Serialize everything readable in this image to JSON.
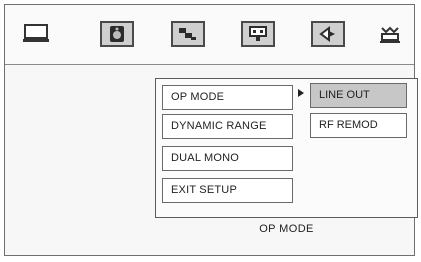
{
  "menu": {
    "items": [
      {
        "label": "OP MODE"
      },
      {
        "label": "DYNAMIC RANGE"
      },
      {
        "label": "DUAL MONO"
      },
      {
        "label": "EXIT SETUP"
      }
    ],
    "submenu": [
      {
        "label": "LINE OUT",
        "selected": true
      },
      {
        "label": "RF REMOD",
        "selected": false
      }
    ]
  },
  "status": {
    "label": "OP MODE"
  },
  "tabs": [
    {
      "icon": "tv-icon"
    },
    {
      "icon": "speaker-box-icon"
    },
    {
      "icon": "picture-icon"
    },
    {
      "icon": "rating-icon"
    },
    {
      "icon": "audio-icon"
    },
    {
      "icon": "setup-icon"
    }
  ],
  "colors": {
    "highlight": "#c7c7c7",
    "border": "#6a6a6a"
  }
}
